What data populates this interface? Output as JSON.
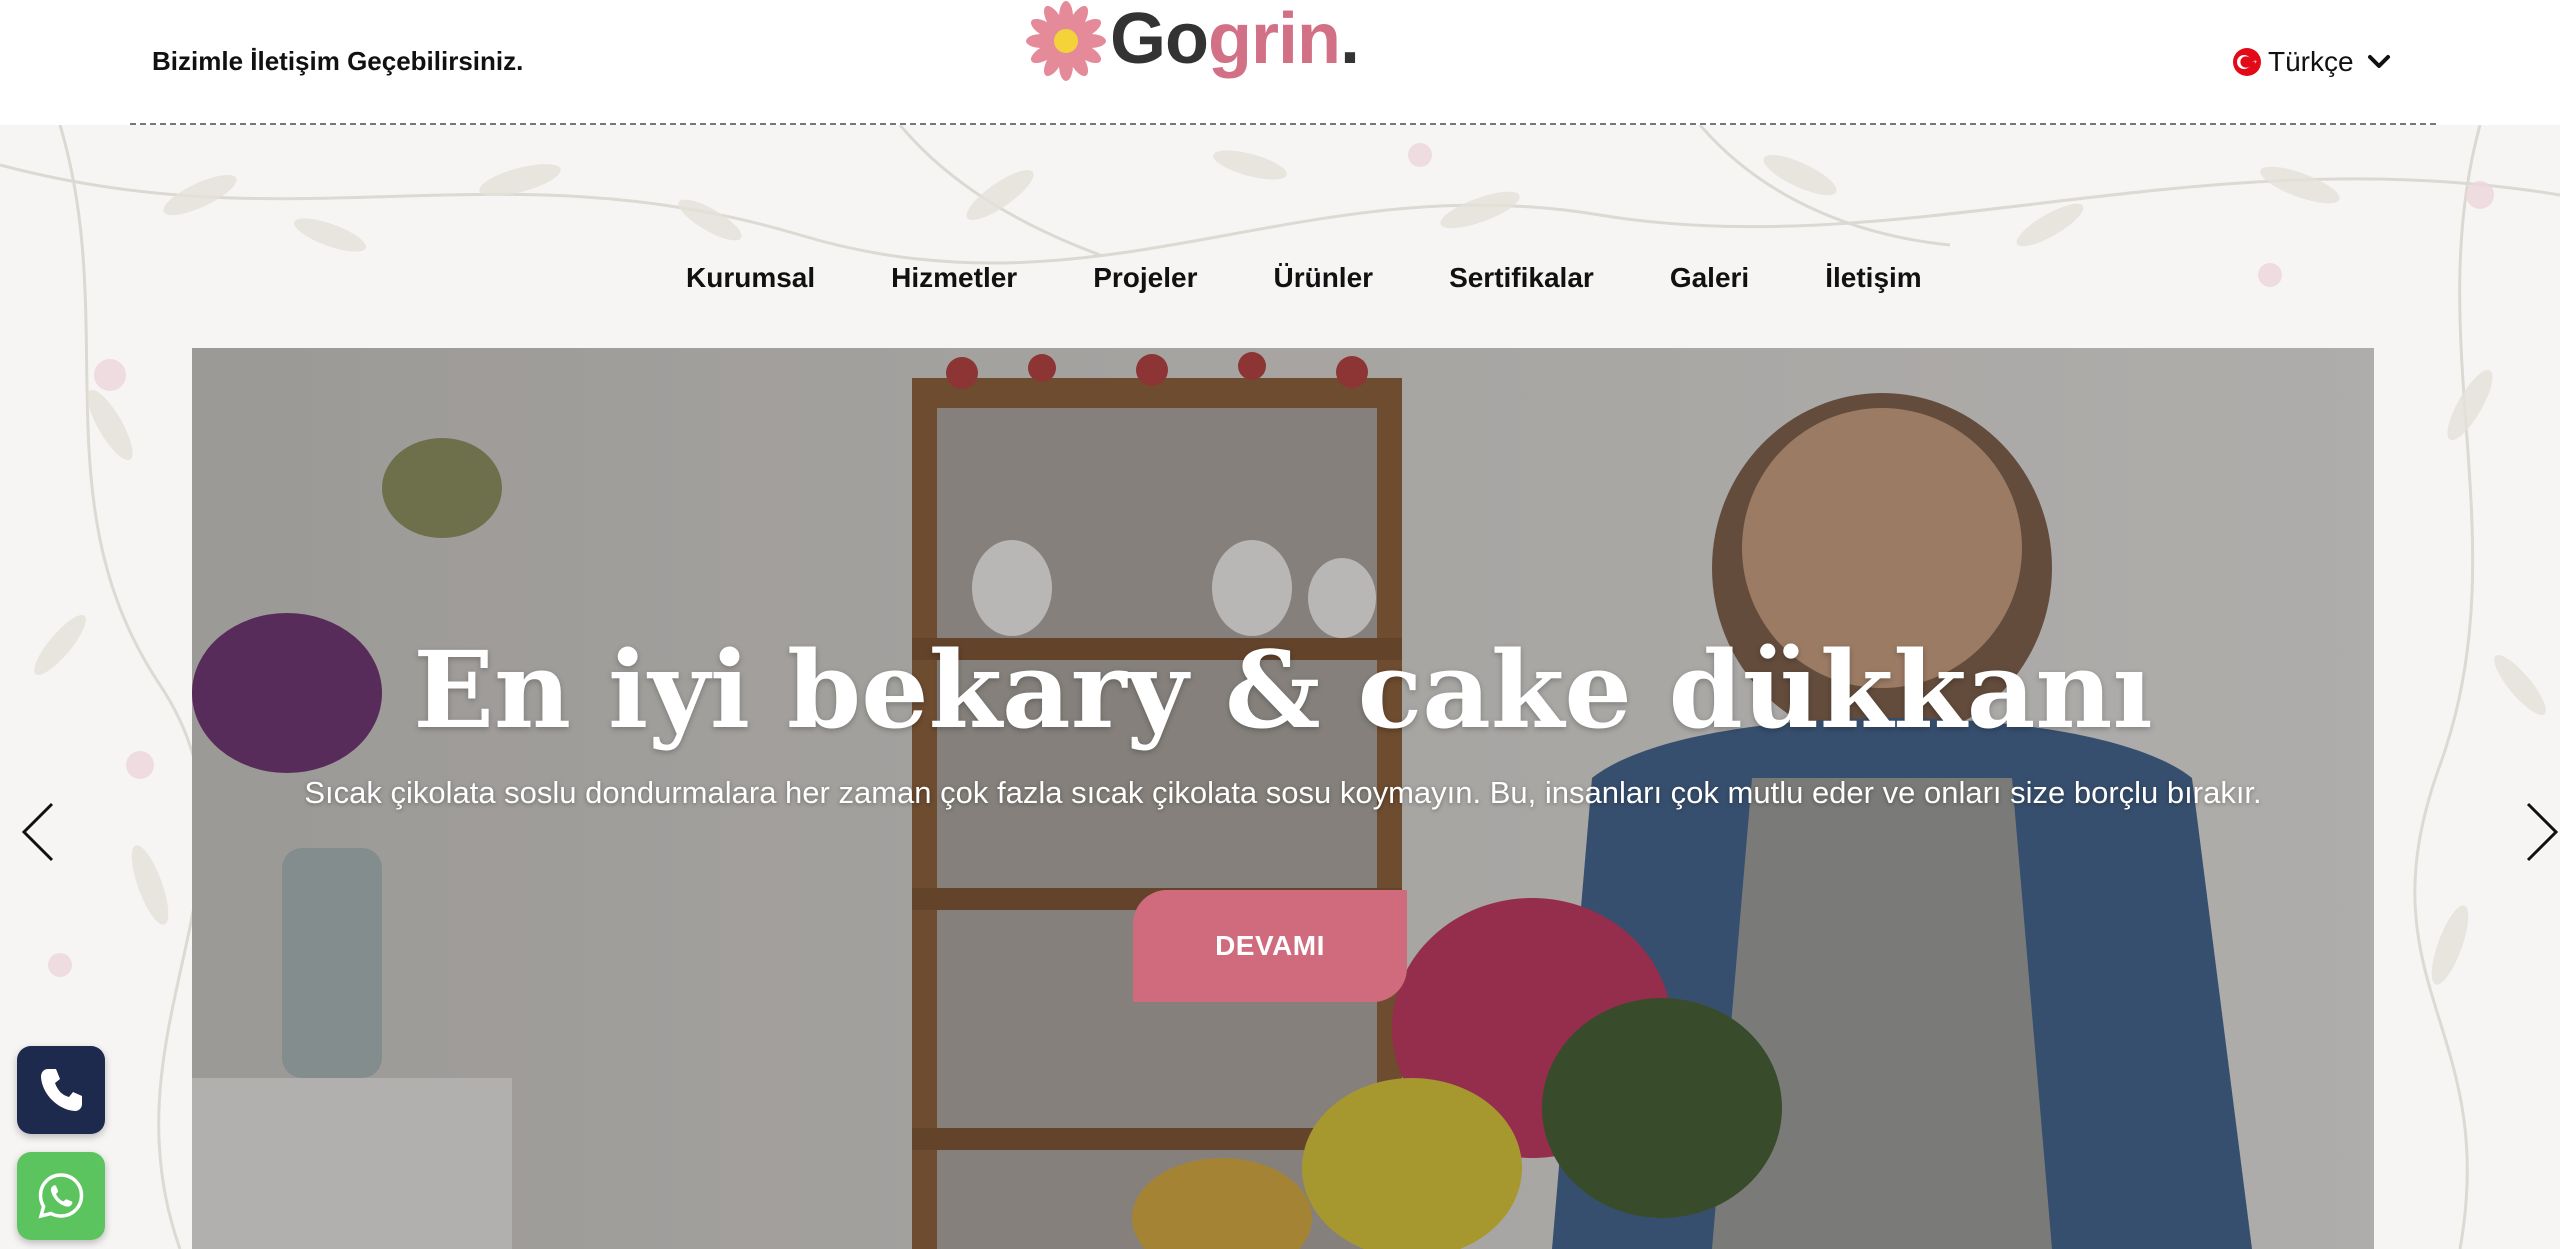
{
  "header": {
    "contact_text": "Bizimle İletişim Geçebilirsiniz.",
    "logo": {
      "part1": "Go",
      "part2": "grin",
      "dot": "."
    },
    "language": {
      "label": "Türkçe",
      "flag": "turkey-flag-icon"
    }
  },
  "nav": {
    "items": [
      {
        "label": "Kurumsal"
      },
      {
        "label": "Hizmetler"
      },
      {
        "label": "Projeler"
      },
      {
        "label": "Ürünler"
      },
      {
        "label": "Sertifikalar"
      },
      {
        "label": "Galeri"
      },
      {
        "label": "İletişim"
      }
    ]
  },
  "hero": {
    "title": "En iyi bekary & cake dükkanı",
    "subtitle": "Sıcak çikolata soslu dondurmalara her zaman çok fazla sıcak çikolata sosu koymayın. Bu, insanları çok mutlu eder ve onları size borçlu bırakır.",
    "button_label": "DEVAMI",
    "prev_icon": "chevron-left-icon",
    "next_icon": "chevron-right-icon"
  },
  "floating": {
    "phone_icon": "phone-icon",
    "whatsapp_icon": "whatsapp-icon"
  },
  "colors": {
    "brand_pink": "#cf6b7c",
    "logo_pink": "#d27086",
    "phone_bg": "#1d2a4e",
    "whatsapp_bg": "#5cc45e"
  }
}
